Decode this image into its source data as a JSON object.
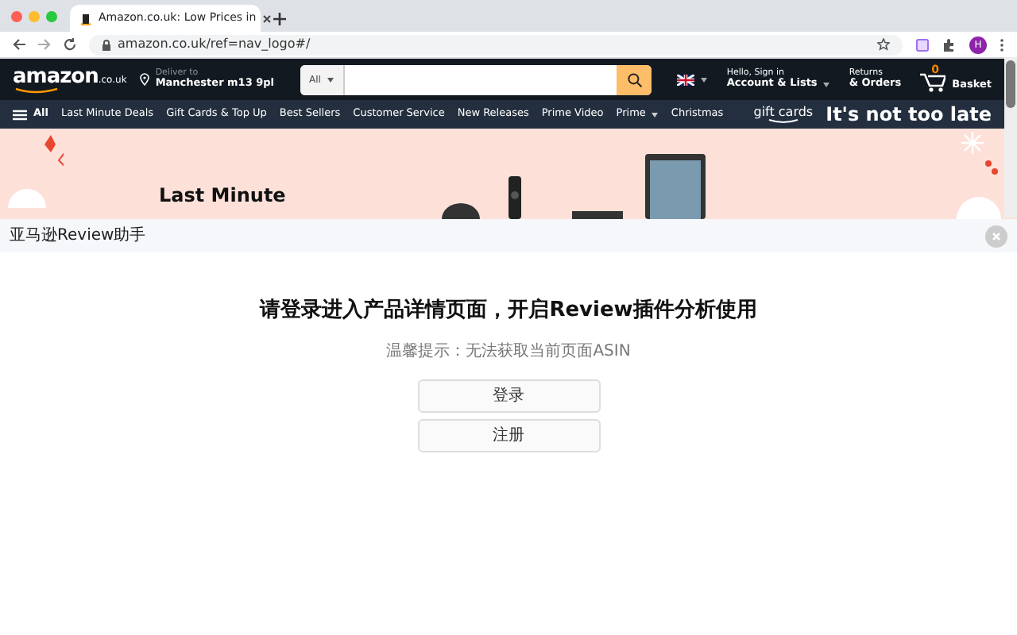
{
  "browser": {
    "tab_title": "Amazon.co.uk: Low Prices in",
    "url": "amazon.co.uk/ref=nav_logo#/",
    "profile_initial": "H"
  },
  "header": {
    "logo": "amazon",
    "logo_suffix": ".co.uk",
    "deliver_label": "Deliver to",
    "deliver_location": "Manchester m13 9pl",
    "search_category": "All",
    "account_greeting": "Hello, Sign in",
    "account_label": "Account & Lists",
    "returns_label": "Returns",
    "orders_label": "& Orders",
    "basket_count": "0",
    "basket_label": "Basket"
  },
  "nav": {
    "all_label": "All",
    "items": [
      {
        "label": "Last Minute Deals",
        "has_menu": false
      },
      {
        "label": "Gift Cards & Top Up",
        "has_menu": false
      },
      {
        "label": "Best Sellers",
        "has_menu": false
      },
      {
        "label": "Customer Service",
        "has_menu": false
      },
      {
        "label": "New Releases",
        "has_menu": false
      },
      {
        "label": "Prime Video",
        "has_menu": false
      },
      {
        "label": "Prime",
        "has_menu": true
      },
      {
        "label": "Christmas",
        "has_menu": false
      }
    ],
    "promo_brand": "gift cards",
    "promo_headline": "It's not too late"
  },
  "banner": {
    "headline": "Last Minute"
  },
  "plugin": {
    "title": "亚马逊Review助手",
    "heading": "请登录进入产品详情页面，开启Review插件分析使用",
    "hint": "温馨提示：无法获取当前页面ASIN",
    "buttons": [
      "登录",
      "注册"
    ]
  }
}
